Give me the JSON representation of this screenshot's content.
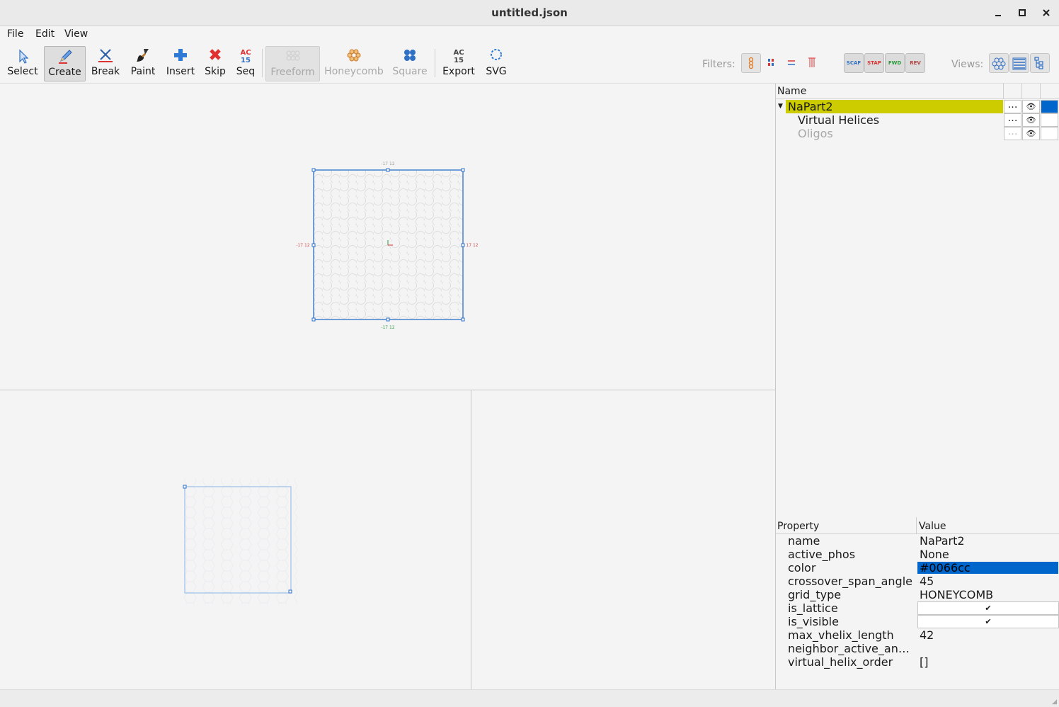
{
  "window": {
    "title": "untitled.json"
  },
  "menubar": {
    "items": [
      "File",
      "Edit",
      "View"
    ]
  },
  "toolbar": {
    "tools": [
      {
        "label": "Select"
      },
      {
        "label": "Create"
      },
      {
        "label": "Break"
      },
      {
        "label": "Paint"
      },
      {
        "label": "Insert"
      },
      {
        "label": "Skip"
      },
      {
        "label": "Seq"
      },
      {
        "label": "Freeform"
      },
      {
        "label": "Honeycomb"
      },
      {
        "label": "Square"
      },
      {
        "label": "Export"
      },
      {
        "label": "SVG"
      }
    ],
    "seq_icon_text": "AC\n15",
    "export_icon_text": "AC\n15",
    "filters_label": "Filters:",
    "strand_filters": [
      "SCAF",
      "STAP",
      "FWD",
      "REV"
    ],
    "views_label": "Views:"
  },
  "slice_view": {
    "label_top": "-17 12",
    "label_bottom": "-17 12",
    "label_left": "-17 12",
    "label_right": "17 12"
  },
  "outliner": {
    "header": "Name",
    "rows": [
      {
        "name": "NaPart2",
        "more": "…",
        "color": "#0066cc"
      },
      {
        "name": "Virtual Helices",
        "more": "…"
      },
      {
        "name": "Oligos",
        "more": "…"
      }
    ]
  },
  "property_editor": {
    "header_property": "Property",
    "header_value": "Value",
    "rows": [
      {
        "key": "name",
        "value": "NaPart2"
      },
      {
        "key": "active_phos",
        "value": "None"
      },
      {
        "key": "color",
        "value": "#0066cc"
      },
      {
        "key": "crossover_span_angle",
        "value": "45"
      },
      {
        "key": "grid_type",
        "value": "HONEYCOMB"
      },
      {
        "key": "is_lattice",
        "value": "✔"
      },
      {
        "key": "is_visible",
        "value": "✔"
      },
      {
        "key": "max_vhelix_length",
        "value": "42"
      },
      {
        "key": "neighbor_active_an…",
        "value": ""
      },
      {
        "key": "virtual_helix_order",
        "value": "[]"
      }
    ]
  },
  "colors": {
    "selection_yellow": "#cccc00",
    "selection_blue": "#0066cc",
    "part_outline": "#2a70c8"
  }
}
